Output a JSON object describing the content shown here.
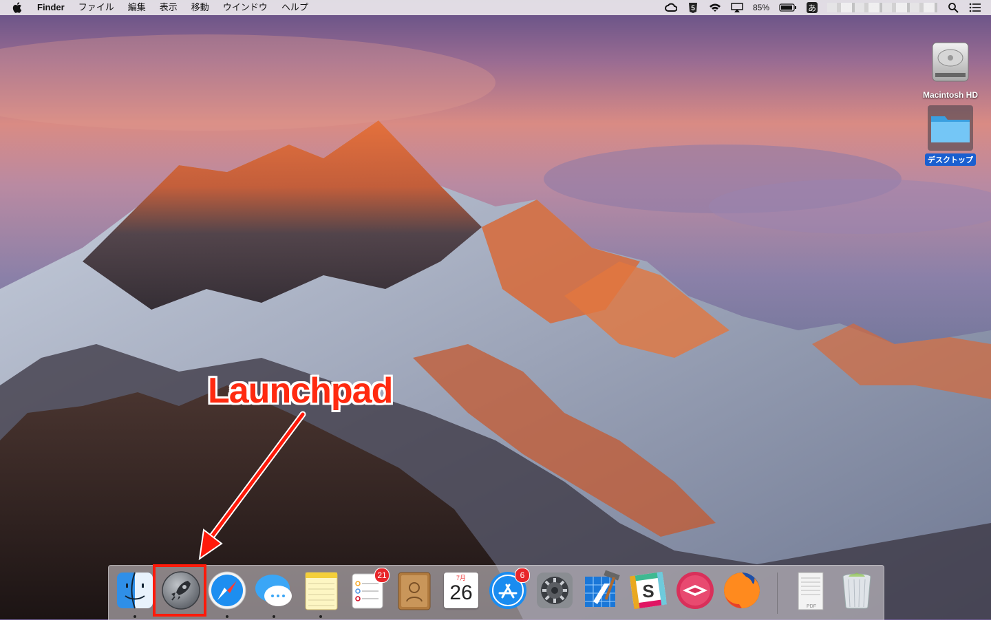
{
  "menubar": {
    "app_name": "Finder",
    "menus": [
      "ファイル",
      "編集",
      "表示",
      "移動",
      "ウインドウ",
      "ヘルプ"
    ],
    "battery_percent": "85%",
    "input_method": "あ",
    "status_icons": [
      "creative-cloud-icon",
      "s-app-icon",
      "wifi-icon",
      "airplay-icon",
      "battery-icon",
      "input-method-icon",
      "spotlight-icon",
      "notification-center-icon"
    ]
  },
  "desktop": {
    "icons": [
      {
        "label": "Macintosh HD",
        "icon": "hard-drive-icon"
      },
      {
        "label": "デスクトップ",
        "icon": "folder-icon",
        "selected": true
      }
    ]
  },
  "annotation": {
    "label": "Launchpad",
    "color": "#ff1a0a"
  },
  "dock": {
    "apps": [
      {
        "name": "Finder",
        "running": true
      },
      {
        "name": "Launchpad",
        "highlighted": true
      },
      {
        "name": "Safari",
        "running": true
      },
      {
        "name": "Messages",
        "running": true
      },
      {
        "name": "Notes",
        "running": true
      },
      {
        "name": "Reminders",
        "badge": "21"
      },
      {
        "name": "Contacts"
      },
      {
        "name": "Calendar",
        "month": "7月",
        "day": "26"
      },
      {
        "name": "App Store",
        "badge": "6"
      },
      {
        "name": "System Preferences"
      },
      {
        "name": "Xcode"
      },
      {
        "name": "Slack"
      },
      {
        "name": "Skitch"
      },
      {
        "name": "Firefox"
      },
      {
        "name": "Document",
        "file_label": "PDF"
      },
      {
        "name": "Trash"
      }
    ]
  }
}
